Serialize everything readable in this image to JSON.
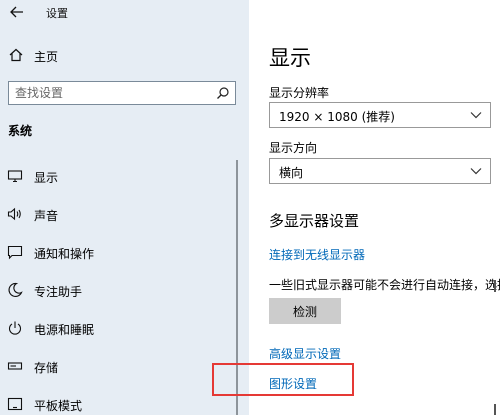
{
  "titlebar": {
    "title": "设置"
  },
  "sidebar": {
    "home_label": "主页",
    "search_placeholder": "查找设置",
    "section_header": "系统",
    "items": [
      {
        "label": "显示",
        "icon": "monitor-icon"
      },
      {
        "label": "声音",
        "icon": "speaker-icon"
      },
      {
        "label": "通知和操作",
        "icon": "notification-icon"
      },
      {
        "label": "专注助手",
        "icon": "moon-icon"
      },
      {
        "label": "电源和睡眠",
        "icon": "power-icon"
      },
      {
        "label": "存储",
        "icon": "storage-icon"
      },
      {
        "label": "平板模式",
        "icon": "tablet-icon"
      }
    ]
  },
  "main": {
    "title": "显示",
    "resolution_label": "显示分辨率",
    "resolution_value": "1920 × 1080 (推荐)",
    "orientation_label": "显示方向",
    "orientation_value": "横向",
    "multi_display_title": "多显示器设置",
    "wireless_link": "连接到无线显示器",
    "info_text": "一些旧式显示器可能不会进行自动连接，选择\"检",
    "detect_button": "检测",
    "advanced_link": "高级显示设置",
    "graphics_link": "图形设置"
  },
  "colors": {
    "sidebar_bg": "#e6edf4",
    "link": "#0068b8",
    "highlight": "#e53935"
  }
}
